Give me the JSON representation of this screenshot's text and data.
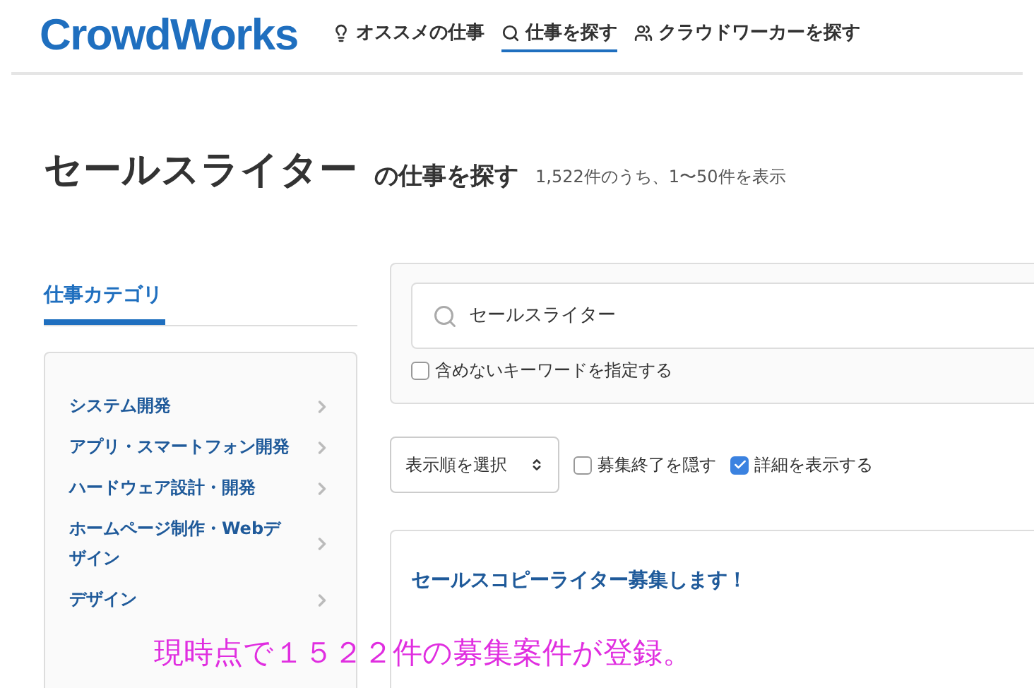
{
  "logo": "CrowdWorks",
  "nav": [
    {
      "label": "オススメの仕事",
      "selected": false
    },
    {
      "label": "仕事を探す",
      "selected": true
    },
    {
      "label": "クラウドワーカーを探す",
      "selected": false
    }
  ],
  "heading": {
    "keyword": "セールスライター",
    "suffix": "の仕事を探す",
    "count": "1,522件のうち、1〜50件を表示"
  },
  "sidebar": {
    "title": "仕事カテゴリ",
    "items": [
      "システム開発",
      "アプリ・スマートフォン開発",
      "ハードウェア設計・開発",
      "ホームページ制作・Webデザイン",
      "デザイン"
    ]
  },
  "search": {
    "value": "セールスライター",
    "exclude": {
      "label": "含めないキーワードを指定する",
      "checked": false
    }
  },
  "sort": {
    "value": "表示順を選択"
  },
  "filters": [
    {
      "label": "募集終了を隠す",
      "checked": false
    },
    {
      "label": "詳細を表示する",
      "checked": true
    }
  ],
  "jobs": [
    {
      "title": "セールスコピーライター募集します！"
    }
  ],
  "caption": "現時点で１５２２件の募集案件が登録。"
}
